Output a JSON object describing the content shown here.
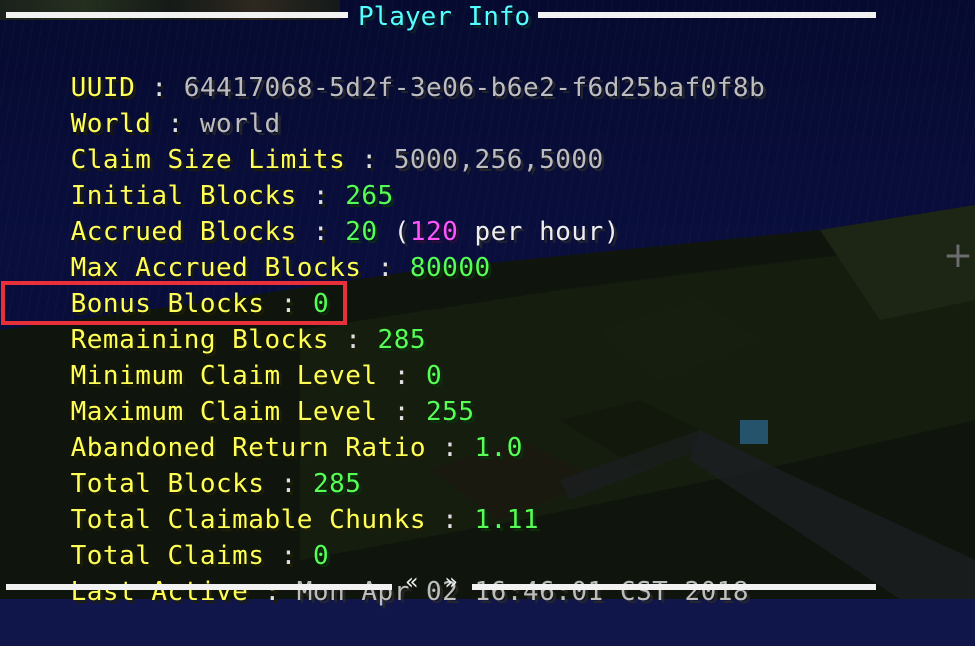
{
  "title": "Player Info",
  "rows": [
    {
      "label": "UUID",
      "sep": " : ",
      "value": "64417068-5d2f-3e06-b6e2-f6d25baf0f8b"
    },
    {
      "label": "World",
      "sep": " : ",
      "value": "world"
    },
    {
      "label": "Claim Size Limits",
      "sep": " : ",
      "value": "5000,256,5000"
    },
    {
      "label": "Initial Blocks",
      "sep": " : ",
      "value": "265"
    },
    {
      "label": "Accrued Blocks",
      "sep": " : ",
      "value": "20",
      "paren_open": " (",
      "rate": "120",
      "rate_suffix": " per hour)"
    },
    {
      "label": "Max Accrued Blocks",
      "sep": " : ",
      "value": "80000"
    },
    {
      "label": "Bonus Blocks",
      "sep": " : ",
      "value": "0"
    },
    {
      "label": "Remaining Blocks",
      "sep": " : ",
      "value": "285"
    },
    {
      "label": "Minimum Claim Level",
      "sep": " : ",
      "value": "0"
    },
    {
      "label": "Maximum Claim Level",
      "sep": " : ",
      "value": "255"
    },
    {
      "label": "Abandoned Return Ratio",
      "sep": " : ",
      "value": "1.0"
    },
    {
      "label": "Total Blocks",
      "sep": " : ",
      "value": "285"
    },
    {
      "label": "Total Claimable Chunks",
      "sep": " : ",
      "value": "1.11"
    },
    {
      "label": "Total Claims",
      "sep": " : ",
      "value": "0"
    },
    {
      "label": "Last Active",
      "sep": " : ",
      "value": "Mon Apr 02 16:46:01 CST 2018"
    }
  ],
  "pager": {
    "prev": "«",
    "next": "»"
  },
  "crosshair": "+",
  "colors": {
    "label": "#ffff55",
    "title": "#55ffff",
    "highlight": "#e8303a"
  }
}
